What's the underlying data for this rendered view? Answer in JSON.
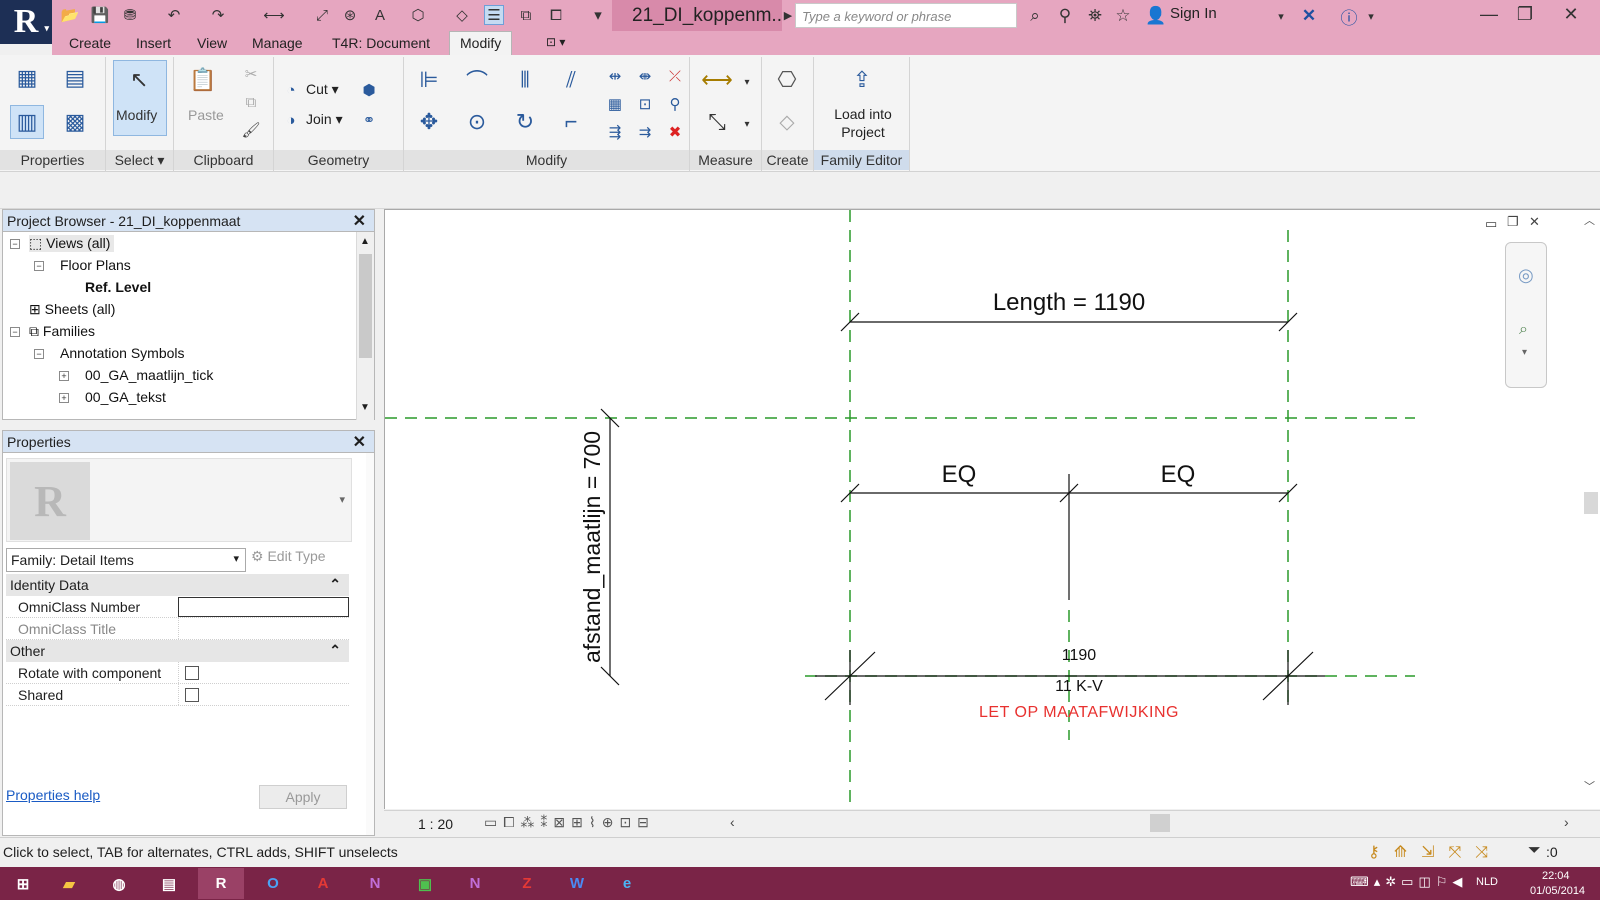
{
  "titlebar": {
    "app_letter": "R",
    "doc_title": "21_DI_koppenm...",
    "search_placeholder": "Type a keyword or phrase",
    "signin": "Sign In"
  },
  "ribbon_tabs": [
    "Create",
    "Insert",
    "View",
    "Manage",
    "T4R: Document",
    "Modify"
  ],
  "ribbon": {
    "panels": [
      "Properties",
      "Select",
      "Clipboard",
      "Geometry",
      "Modify",
      "Measure",
      "Create",
      "Family Editor"
    ],
    "modify_label": "Modify",
    "paste_label": "Paste",
    "cut_label": "Cut",
    "join_label": "Join",
    "load_into_project": "Load into Project"
  },
  "project_browser": {
    "title": "Project Browser - 21_DI_koppenmaat",
    "items": [
      "Views (all)",
      "Floor Plans",
      "Ref. Level",
      "Sheets (all)",
      "Families",
      "Annotation Symbols",
      "00_GA_maatlijn_tick",
      "00_GA_tekst"
    ]
  },
  "properties": {
    "title": "Properties",
    "family_selector": "Family: Detail Items",
    "edit_type": "Edit Type",
    "group_identity": "Identity Data",
    "omniclass_number": "OmniClass Number",
    "omniclass_title": "OmniClass Title",
    "group_other": "Other",
    "rotate_with_component": "Rotate with component",
    "shared": "Shared",
    "help_link": "Properties help",
    "apply": "Apply"
  },
  "drawing": {
    "length_label": "Length = 1190",
    "eq_left": "EQ",
    "eq_right": "EQ",
    "vertical_label": "afstand_maatlijn = 700",
    "value_1190": "1190",
    "code": "11 K-V",
    "warning": "LET OP MAATAFWIJKING",
    "warning_color": "#e8312f",
    "ref_plane_color": "#2a9a2a"
  },
  "view_controls": {
    "scale": "1 : 20"
  },
  "statusbar": {
    "text": "Click to select, TAB for alternates, CTRL adds, SHIFT unselects",
    "filter_count": ":0"
  },
  "taskbar": {
    "lang": "NLD",
    "time": "22:04",
    "date": "01/05/2014"
  }
}
